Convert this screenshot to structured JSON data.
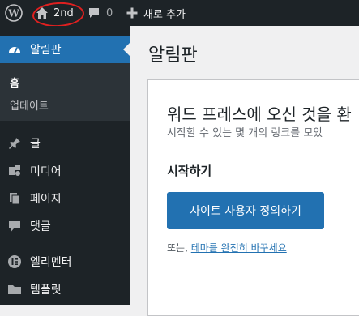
{
  "admin_bar": {
    "site_name": "2nd",
    "comment_count": "0",
    "new_label": "새로 추가"
  },
  "sidebar": {
    "current": "알림판",
    "submenu": [
      "홈",
      "업데이트"
    ],
    "items": [
      "글",
      "미디어",
      "페이지",
      "댓글",
      "엘리멘터",
      "템플릿"
    ]
  },
  "main": {
    "page_title": "알림판",
    "welcome_title": "워드 프레스에 오신 것을 환",
    "welcome_sub": "시작할 수 있는 몇 개의 링크를 모았",
    "start_heading": "시작하기",
    "primary_button": "사이트 사용자 정의하기",
    "alt_prefix": "또는, ",
    "alt_link": "테마를 완전히 바꾸세요"
  },
  "colors": {
    "admin_bar_bg": "#1d2327",
    "accent": "#2271b1",
    "annotation": "#e02020"
  }
}
